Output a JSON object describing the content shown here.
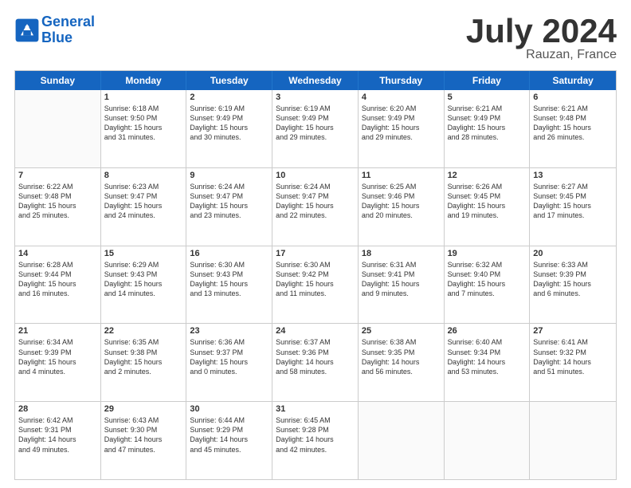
{
  "logo": {
    "line1": "General",
    "line2": "Blue"
  },
  "title": "July 2024",
  "location": "Rauzan, France",
  "days": [
    "Sunday",
    "Monday",
    "Tuesday",
    "Wednesday",
    "Thursday",
    "Friday",
    "Saturday"
  ],
  "rows": [
    [
      {
        "day": "",
        "info": ""
      },
      {
        "day": "1",
        "info": "Sunrise: 6:18 AM\nSunset: 9:50 PM\nDaylight: 15 hours\nand 31 minutes."
      },
      {
        "day": "2",
        "info": "Sunrise: 6:19 AM\nSunset: 9:49 PM\nDaylight: 15 hours\nand 30 minutes."
      },
      {
        "day": "3",
        "info": "Sunrise: 6:19 AM\nSunset: 9:49 PM\nDaylight: 15 hours\nand 29 minutes."
      },
      {
        "day": "4",
        "info": "Sunrise: 6:20 AM\nSunset: 9:49 PM\nDaylight: 15 hours\nand 29 minutes."
      },
      {
        "day": "5",
        "info": "Sunrise: 6:21 AM\nSunset: 9:49 PM\nDaylight: 15 hours\nand 28 minutes."
      },
      {
        "day": "6",
        "info": "Sunrise: 6:21 AM\nSunset: 9:48 PM\nDaylight: 15 hours\nand 26 minutes."
      }
    ],
    [
      {
        "day": "7",
        "info": "Sunrise: 6:22 AM\nSunset: 9:48 PM\nDaylight: 15 hours\nand 25 minutes."
      },
      {
        "day": "8",
        "info": "Sunrise: 6:23 AM\nSunset: 9:47 PM\nDaylight: 15 hours\nand 24 minutes."
      },
      {
        "day": "9",
        "info": "Sunrise: 6:24 AM\nSunset: 9:47 PM\nDaylight: 15 hours\nand 23 minutes."
      },
      {
        "day": "10",
        "info": "Sunrise: 6:24 AM\nSunset: 9:47 PM\nDaylight: 15 hours\nand 22 minutes."
      },
      {
        "day": "11",
        "info": "Sunrise: 6:25 AM\nSunset: 9:46 PM\nDaylight: 15 hours\nand 20 minutes."
      },
      {
        "day": "12",
        "info": "Sunrise: 6:26 AM\nSunset: 9:45 PM\nDaylight: 15 hours\nand 19 minutes."
      },
      {
        "day": "13",
        "info": "Sunrise: 6:27 AM\nSunset: 9:45 PM\nDaylight: 15 hours\nand 17 minutes."
      }
    ],
    [
      {
        "day": "14",
        "info": "Sunrise: 6:28 AM\nSunset: 9:44 PM\nDaylight: 15 hours\nand 16 minutes."
      },
      {
        "day": "15",
        "info": "Sunrise: 6:29 AM\nSunset: 9:43 PM\nDaylight: 15 hours\nand 14 minutes."
      },
      {
        "day": "16",
        "info": "Sunrise: 6:30 AM\nSunset: 9:43 PM\nDaylight: 15 hours\nand 13 minutes."
      },
      {
        "day": "17",
        "info": "Sunrise: 6:30 AM\nSunset: 9:42 PM\nDaylight: 15 hours\nand 11 minutes."
      },
      {
        "day": "18",
        "info": "Sunrise: 6:31 AM\nSunset: 9:41 PM\nDaylight: 15 hours\nand 9 minutes."
      },
      {
        "day": "19",
        "info": "Sunrise: 6:32 AM\nSunset: 9:40 PM\nDaylight: 15 hours\nand 7 minutes."
      },
      {
        "day": "20",
        "info": "Sunrise: 6:33 AM\nSunset: 9:39 PM\nDaylight: 15 hours\nand 6 minutes."
      }
    ],
    [
      {
        "day": "21",
        "info": "Sunrise: 6:34 AM\nSunset: 9:39 PM\nDaylight: 15 hours\nand 4 minutes."
      },
      {
        "day": "22",
        "info": "Sunrise: 6:35 AM\nSunset: 9:38 PM\nDaylight: 15 hours\nand 2 minutes."
      },
      {
        "day": "23",
        "info": "Sunrise: 6:36 AM\nSunset: 9:37 PM\nDaylight: 15 hours\nand 0 minutes."
      },
      {
        "day": "24",
        "info": "Sunrise: 6:37 AM\nSunset: 9:36 PM\nDaylight: 14 hours\nand 58 minutes."
      },
      {
        "day": "25",
        "info": "Sunrise: 6:38 AM\nSunset: 9:35 PM\nDaylight: 14 hours\nand 56 minutes."
      },
      {
        "day": "26",
        "info": "Sunrise: 6:40 AM\nSunset: 9:34 PM\nDaylight: 14 hours\nand 53 minutes."
      },
      {
        "day": "27",
        "info": "Sunrise: 6:41 AM\nSunset: 9:32 PM\nDaylight: 14 hours\nand 51 minutes."
      }
    ],
    [
      {
        "day": "28",
        "info": "Sunrise: 6:42 AM\nSunset: 9:31 PM\nDaylight: 14 hours\nand 49 minutes."
      },
      {
        "day": "29",
        "info": "Sunrise: 6:43 AM\nSunset: 9:30 PM\nDaylight: 14 hours\nand 47 minutes."
      },
      {
        "day": "30",
        "info": "Sunrise: 6:44 AM\nSunset: 9:29 PM\nDaylight: 14 hours\nand 45 minutes."
      },
      {
        "day": "31",
        "info": "Sunrise: 6:45 AM\nSunset: 9:28 PM\nDaylight: 14 hours\nand 42 minutes."
      },
      {
        "day": "",
        "info": ""
      },
      {
        "day": "",
        "info": ""
      },
      {
        "day": "",
        "info": ""
      }
    ]
  ]
}
